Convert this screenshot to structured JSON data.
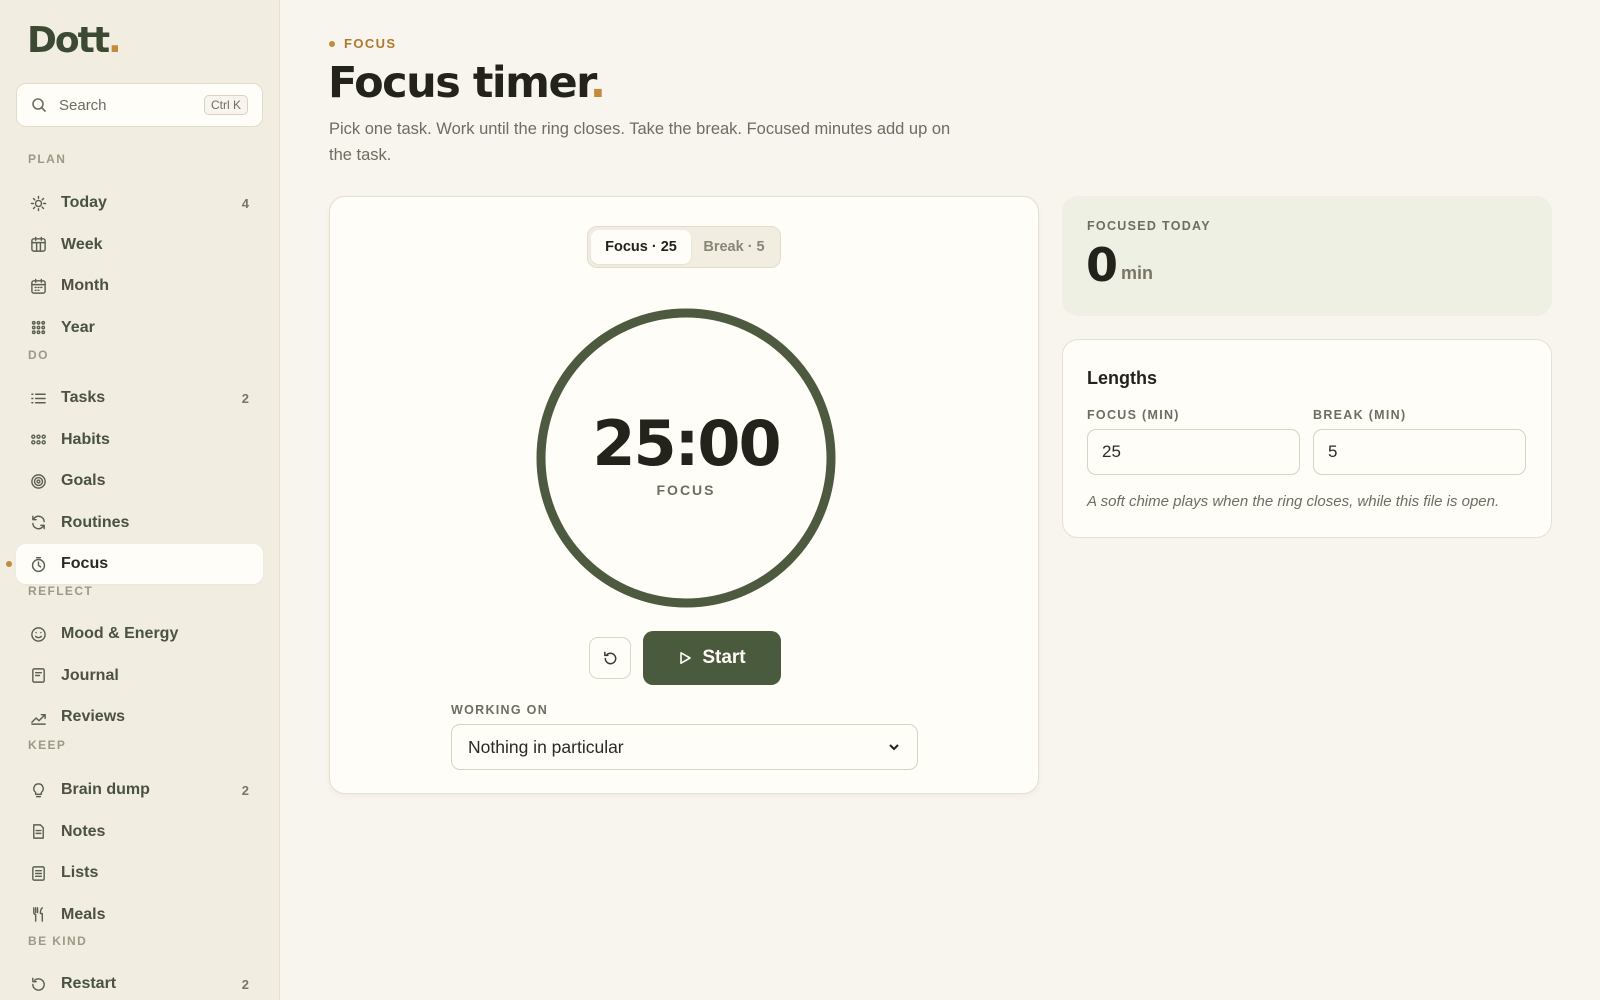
{
  "app": {
    "logo_text": "Dott",
    "logo_dot": "."
  },
  "search": {
    "placeholder": "Search",
    "shortcut": "Ctrl K"
  },
  "sidebar": {
    "sections": [
      {
        "label": "PLAN",
        "items": [
          {
            "label": "Today",
            "icon": "sun-icon",
            "count": "4"
          },
          {
            "label": "Week",
            "icon": "calendar-week-icon",
            "count": ""
          },
          {
            "label": "Month",
            "icon": "calendar-month-icon",
            "count": ""
          },
          {
            "label": "Year",
            "icon": "grid-icon",
            "count": ""
          }
        ]
      },
      {
        "label": "DO",
        "items": [
          {
            "label": "Tasks",
            "icon": "list-icon",
            "count": "2"
          },
          {
            "label": "Habits",
            "icon": "dots-grid-icon",
            "count": ""
          },
          {
            "label": "Goals",
            "icon": "target-icon",
            "count": ""
          },
          {
            "label": "Routines",
            "icon": "refresh-icon",
            "count": ""
          },
          {
            "label": "Focus",
            "icon": "clock-icon",
            "count": "",
            "active": true
          }
        ]
      },
      {
        "label": "REFLECT",
        "items": [
          {
            "label": "Mood & Energy",
            "icon": "smile-icon",
            "count": ""
          },
          {
            "label": "Journal",
            "icon": "book-icon",
            "count": ""
          },
          {
            "label": "Reviews",
            "icon": "trend-icon",
            "count": ""
          }
        ]
      },
      {
        "label": "KEEP",
        "items": [
          {
            "label": "Brain dump",
            "icon": "lightbulb-icon",
            "count": "2"
          },
          {
            "label": "Notes",
            "icon": "note-icon",
            "count": ""
          },
          {
            "label": "Lists",
            "icon": "checklist-icon",
            "count": ""
          },
          {
            "label": "Meals",
            "icon": "fork-knife-icon",
            "count": ""
          }
        ]
      },
      {
        "label": "BE KIND",
        "items": [
          {
            "label": "Restart",
            "icon": "restart-icon",
            "count": "2"
          }
        ]
      }
    ]
  },
  "header": {
    "eyebrow": "FOCUS",
    "title": "Focus timer",
    "title_dot": ".",
    "subtitle": "Pick one task. Work until the ring closes. Take the break. Focused minutes add up on the task."
  },
  "timer": {
    "modes": [
      {
        "label": "Focus · 25",
        "active": true
      },
      {
        "label": "Break · 5",
        "active": false
      }
    ],
    "time": "25:00",
    "mode_label": "FOCUS",
    "progress": 1.0,
    "start_label": "Start",
    "working_on_label": "WORKING ON",
    "working_on_value": "Nothing in particular"
  },
  "focused_today": {
    "label": "FOCUSED TODAY",
    "value": "0",
    "unit": "min"
  },
  "lengths": {
    "title": "Lengths",
    "focus_label": "FOCUS (MIN)",
    "focus_value": "25",
    "break_label": "BREAK (MIN)",
    "break_value": "5",
    "note": "A soft chime plays when the ring closes, while this file is open."
  },
  "colors": {
    "accent": "#c28a3c",
    "primary": "#4a5a3c",
    "ring": "#4d5a3f"
  }
}
